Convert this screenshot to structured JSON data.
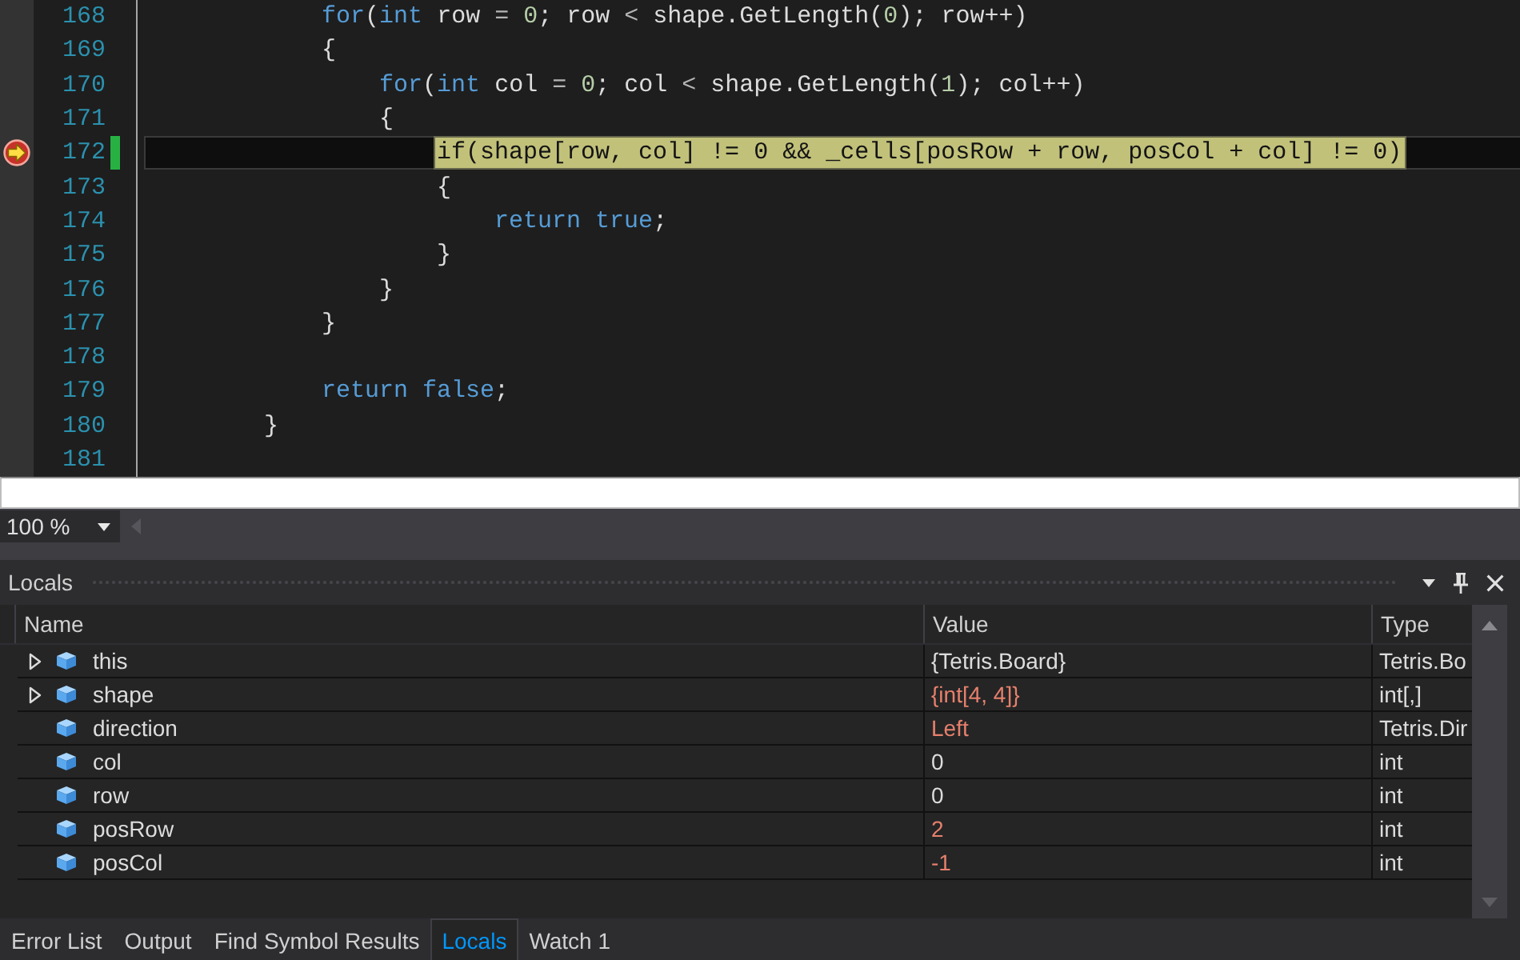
{
  "editor": {
    "lines": [
      {
        "children": [
          {
            "number": "168",
            "tokens": [
              {
                "kind": "keyword",
                "text": "for"
              },
              {
                "kind": "plain",
                "text": "("
              },
              {
                "kind": "keyword",
                "text": "int"
              },
              {
                "kind": "plain",
                "text": " row"
              },
              {
                "kind": "operator",
                "text": " = "
              },
              {
                "kind": "number",
                "text": "0"
              },
              {
                "kind": "plain",
                "text": "; row"
              },
              {
                "kind": "operator",
                "text": " < "
              },
              {
                "kind": "plain",
                "text": "shape.GetLength("
              },
              {
                "kind": "number",
                "text": "0"
              },
              {
                "kind": "plain",
                "text": "); row++)"
              }
            ],
            "breakpoint": false,
            "current": false,
            "changed": false
          },
          {
            "number": "169",
            "tokens": [
              {
                "kind": "plain",
                "text": "{"
              }
            ],
            "breakpoint": false,
            "current": false,
            "changed": false,
            "children": [
              {
                "number": "170",
                "tokens": [
                  {
                    "kind": "keyword",
                    "text": "for"
                  },
                  {
                    "kind": "plain",
                    "text": "("
                  },
                  {
                    "kind": "keyword",
                    "text": "int"
                  },
                  {
                    "kind": "plain",
                    "text": " col"
                  },
                  {
                    "kind": "operator",
                    "text": " = "
                  },
                  {
                    "kind": "number",
                    "text": "0"
                  },
                  {
                    "kind": "plain",
                    "text": "; col"
                  },
                  {
                    "kind": "operator",
                    "text": " < "
                  },
                  {
                    "kind": "plain",
                    "text": "shape.GetLength("
                  },
                  {
                    "kind": "number",
                    "text": "1"
                  },
                  {
                    "kind": "plain",
                    "text": "); col++)"
                  }
                ],
                "breakpoint": false,
                "current": false,
                "changed": false
              },
              {
                "number": "171",
                "tokens": [
                  {
                    "kind": "plain",
                    "text": "{"
                  }
                ],
                "breakpoint": false,
                "current": false,
                "changed": false,
                "children": [
                  {
                    "number": "172",
                    "tokens": [
                      {
                        "kind": "keyword",
                        "text": "if"
                      },
                      {
                        "kind": "plain",
                        "text": "(shape[row, col] != "
                      },
                      {
                        "kind": "number",
                        "text": "0"
                      },
                      {
                        "kind": "plain",
                        "text": " && _cells[posRow + row, posCol + col] != "
                      },
                      {
                        "kind": "number",
                        "text": "0"
                      },
                      {
                        "kind": "plain",
                        "text": ")"
                      }
                    ],
                    "breakpoint": true,
                    "current": true,
                    "changed": true
                  },
                  {
                    "number": "173",
                    "tokens": [
                      {
                        "kind": "plain",
                        "text": "{"
                      }
                    ],
                    "breakpoint": false,
                    "current": false,
                    "changed": false,
                    "children": [
                      {
                        "number": "174",
                        "tokens": [
                          {
                            "kind": "keyword",
                            "text": "return"
                          },
                          {
                            "kind": "keyword",
                            "text": " true"
                          },
                          {
                            "kind": "plain",
                            "text": ";"
                          }
                        ],
                        "breakpoint": false,
                        "current": false,
                        "changed": false
                      }
                    ]
                  },
                  {
                    "number": "175",
                    "tokens": [
                      {
                        "kind": "plain",
                        "text": "}"
                      }
                    ],
                    "breakpoint": false,
                    "current": false,
                    "changed": false
                  }
                ]
              },
              {
                "number": "176",
                "tokens": [
                  {
                    "kind": "plain",
                    "text": "}"
                  }
                ],
                "breakpoint": false,
                "current": false,
                "changed": false
              }
            ]
          },
          {
            "number": "177",
            "tokens": [
              {
                "kind": "plain",
                "text": "}"
              }
            ],
            "breakpoint": false,
            "current": false,
            "changed": false
          },
          {
            "number": "178",
            "breakpoint": false,
            "current": false,
            "changed": false
          },
          {
            "number": "179",
            "tokens": [
              {
                "kind": "keyword",
                "text": "return"
              },
              {
                "kind": "keyword",
                "text": " false"
              },
              {
                "kind": "plain",
                "text": ";"
              }
            ],
            "breakpoint": false,
            "current": false,
            "changed": false
          }
        ]
      },
      {
        "number": "180",
        "tokens": [
          {
            "kind": "plain",
            "text": "}"
          }
        ],
        "breakpoint": false,
        "current": false,
        "changed": false
      },
      {
        "number": "181",
        "breakpoint": false,
        "current": false,
        "changed": false
      }
    ]
  },
  "zoom": {
    "value": "100 %"
  },
  "locals": {
    "title": "Locals",
    "columns": [
      "Name",
      "Value",
      "Type"
    ],
    "rows": [
      {
        "name": "this",
        "value": "{Tetris.Board}",
        "type": "Tetris.Bo",
        "expandable": true,
        "changed": false
      },
      {
        "name": "shape",
        "value": "{int[4, 4]}",
        "type": "int[,]",
        "expandable": true,
        "changed": true
      },
      {
        "name": "direction",
        "value": "Left",
        "type": "Tetris.Dir",
        "expandable": false,
        "changed": true
      },
      {
        "name": "col",
        "value": "0",
        "type": "int",
        "expandable": false,
        "changed": false
      },
      {
        "name": "row",
        "value": "0",
        "type": "int",
        "expandable": false,
        "changed": false
      },
      {
        "name": "posRow",
        "value": "2",
        "type": "int",
        "expandable": false,
        "changed": true
      },
      {
        "name": "posCol",
        "value": "-1",
        "type": "int",
        "expandable": false,
        "changed": true
      }
    ]
  },
  "tabs": [
    {
      "label": "Error List",
      "selected": false
    },
    {
      "label": "Output",
      "selected": false
    },
    {
      "label": "Find Symbol Results",
      "selected": false
    },
    {
      "label": "Locals",
      "selected": true
    },
    {
      "label": "Watch 1",
      "selected": false
    }
  ]
}
